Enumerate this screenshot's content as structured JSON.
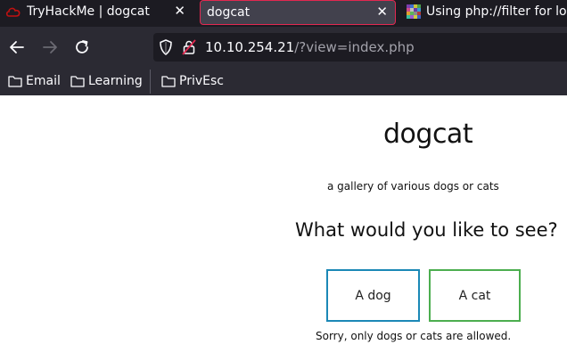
{
  "tabs": [
    {
      "title": "TryHackMe | dogcat",
      "icon": "tryhackme-cloud-icon",
      "active": false
    },
    {
      "title": "dogcat",
      "icon": null,
      "active": true
    },
    {
      "title": "Using php://filter for lo",
      "icon": "mosaic-favicon-icon",
      "active": false
    }
  ],
  "address_bar": {
    "host": "10.10.254.21",
    "path": "/?view=index.php"
  },
  "bookmarks": [
    {
      "label": "Email",
      "icon": "folder-icon"
    },
    {
      "label": "Learning",
      "icon": "folder-icon"
    },
    {
      "label": "PrivEsc",
      "icon": "folder-icon"
    }
  ],
  "page": {
    "title": "dogcat",
    "subtitle": "a gallery of various dogs or cats",
    "question": "What would you like to see?",
    "buttons": {
      "dog": "A dog",
      "cat": "A cat"
    },
    "message": "Sorry, only dogs or cats are allowed."
  },
  "colors": {
    "tabstrip_bg": "#1c1b22",
    "toolbar_bg": "#2b2a33",
    "active_tab_border": "#e22850",
    "dog_button_border": "#1b88b6",
    "cat_button_border": "#4cae4f"
  }
}
